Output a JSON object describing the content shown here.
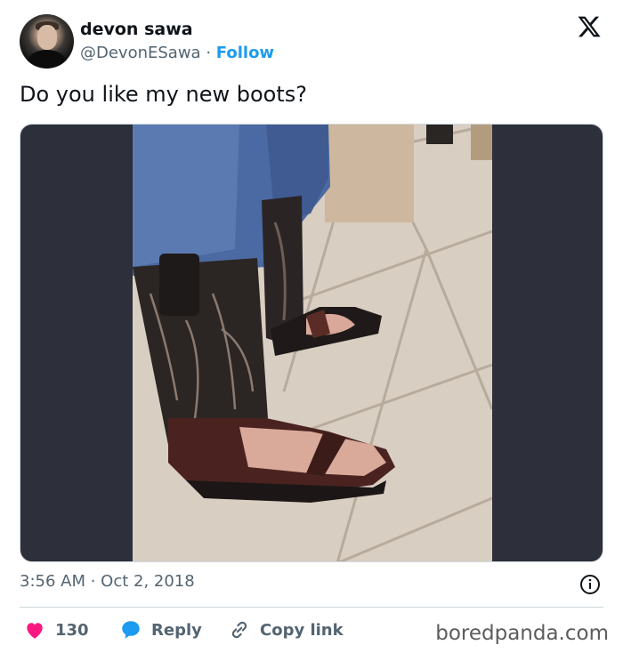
{
  "author": {
    "name": "devon sawa",
    "handle": "@DevonESawa",
    "separator": "·",
    "follow_label": "Follow"
  },
  "tweet": {
    "text": "Do you like my new boots?",
    "timestamp": "3:56 AM · Oct 2, 2018"
  },
  "actions": {
    "likes_count": "130",
    "reply_label": "Reply",
    "copy_link_label": "Copy link"
  },
  "watermark": "boredpanda.com",
  "colors": {
    "accent": "#1d9bf0",
    "like": "#f91880",
    "text": "#0f1419",
    "muted": "#536471",
    "media_bg": "#2d2f3a"
  },
  "icons": [
    "x-logo-icon",
    "info-icon",
    "heart-icon",
    "reply-bubble-icon",
    "link-icon"
  ]
}
